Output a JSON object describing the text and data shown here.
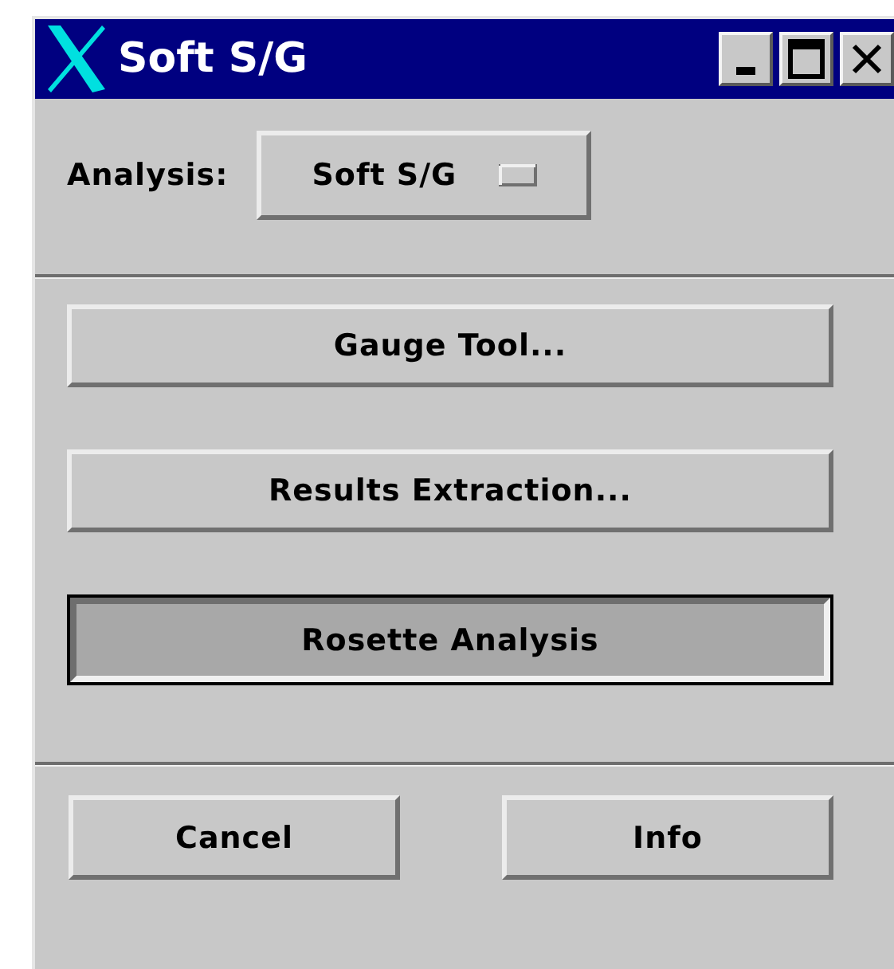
{
  "window": {
    "title": "Soft S/G"
  },
  "analysis": {
    "label": "Analysis:",
    "value": "Soft S/G"
  },
  "actions": [
    {
      "label": "Gauge Tool...",
      "selected": false
    },
    {
      "label": "Results Extraction...",
      "selected": false
    },
    {
      "label": "Rosette Analysis",
      "selected": true
    }
  ],
  "buttons": [
    "Cancel",
    "Info"
  ]
}
